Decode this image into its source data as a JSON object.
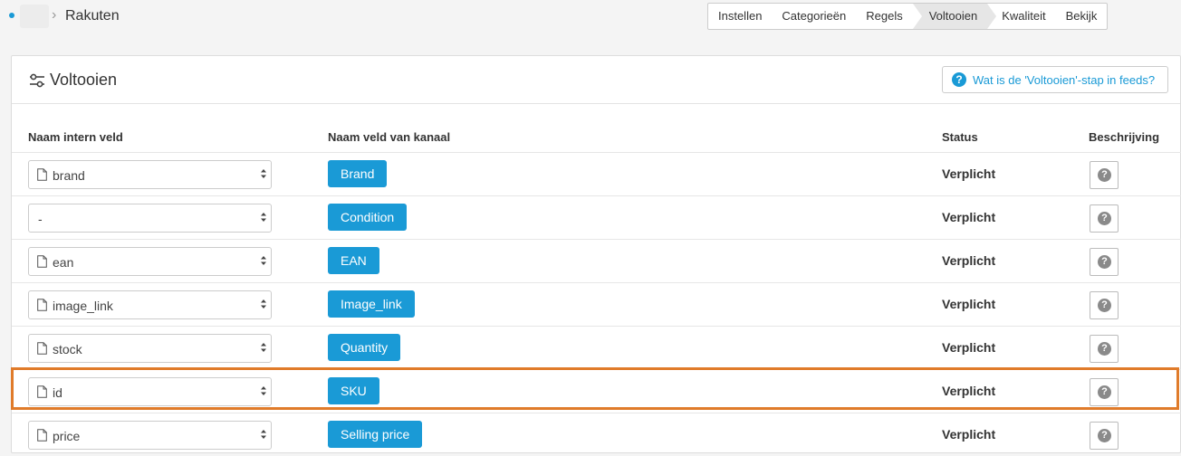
{
  "breadcrumb": {
    "title": "Rakuten"
  },
  "steps": [
    {
      "label": "Instellen"
    },
    {
      "label": "Categorieën"
    },
    {
      "label": "Regels"
    },
    {
      "label": "Voltooien"
    },
    {
      "label": "Kwaliteit"
    },
    {
      "label": "Bekijk"
    }
  ],
  "active_step": "Voltooien",
  "panel": {
    "title": "Voltooien",
    "help_label": "Wat is de 'Voltooien'-stap in feeds?"
  },
  "table": {
    "headers": {
      "internal": "Naam intern veld",
      "channel": "Naam veld van kanaal",
      "status": "Status",
      "description": "Beschrijving"
    },
    "rows": [
      {
        "internal": "brand",
        "has_doc_icon": true,
        "channel": "Brand",
        "status": "Verplicht"
      },
      {
        "internal": "-",
        "has_doc_icon": false,
        "channel": "Condition",
        "status": "Verplicht"
      },
      {
        "internal": "ean",
        "has_doc_icon": true,
        "channel": "EAN",
        "status": "Verplicht"
      },
      {
        "internal": "image_link",
        "has_doc_icon": true,
        "channel": "Image_link",
        "status": "Verplicht"
      },
      {
        "internal": "stock",
        "has_doc_icon": true,
        "channel": "Quantity",
        "status": "Verplicht"
      },
      {
        "internal": "id",
        "has_doc_icon": true,
        "channel": "SKU",
        "status": "Verplicht",
        "highlighted": true
      },
      {
        "internal": "price",
        "has_doc_icon": true,
        "channel": "Selling price",
        "status": "Verplicht"
      }
    ]
  },
  "colors": {
    "accent": "#1a9ad6",
    "highlight": "#e07b2a",
    "help_icon": "#8a8a8a"
  },
  "icons": {
    "settings": "sliders-icon",
    "help": "question-circle-icon",
    "document": "document-icon",
    "select_arrows": "sort-arrows-icon"
  }
}
